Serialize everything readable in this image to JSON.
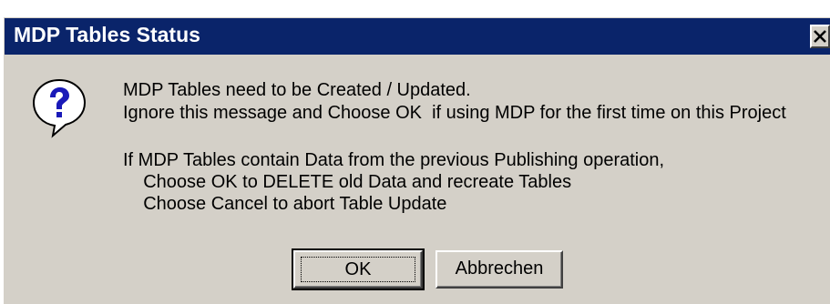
{
  "dialog": {
    "title": "MDP Tables Status",
    "close_glyph": "✕",
    "icon": "question-icon",
    "message_lines": [
      "MDP Tables need to be Created / Updated.",
      "Ignore this message and Choose OK  if using MDP for the first time on this Project",
      "If MDP Tables contain Data from the previous Publishing operation,",
      "    Choose OK to DELETE old Data and recreate Tables",
      "    Choose Cancel to abort Table Update"
    ],
    "ok_label": "OK",
    "cancel_label": "Abbrechen"
  },
  "colors": {
    "titlebar": "#0a246a",
    "window_face": "#d4d0c8",
    "title_text": "#ffffff"
  }
}
